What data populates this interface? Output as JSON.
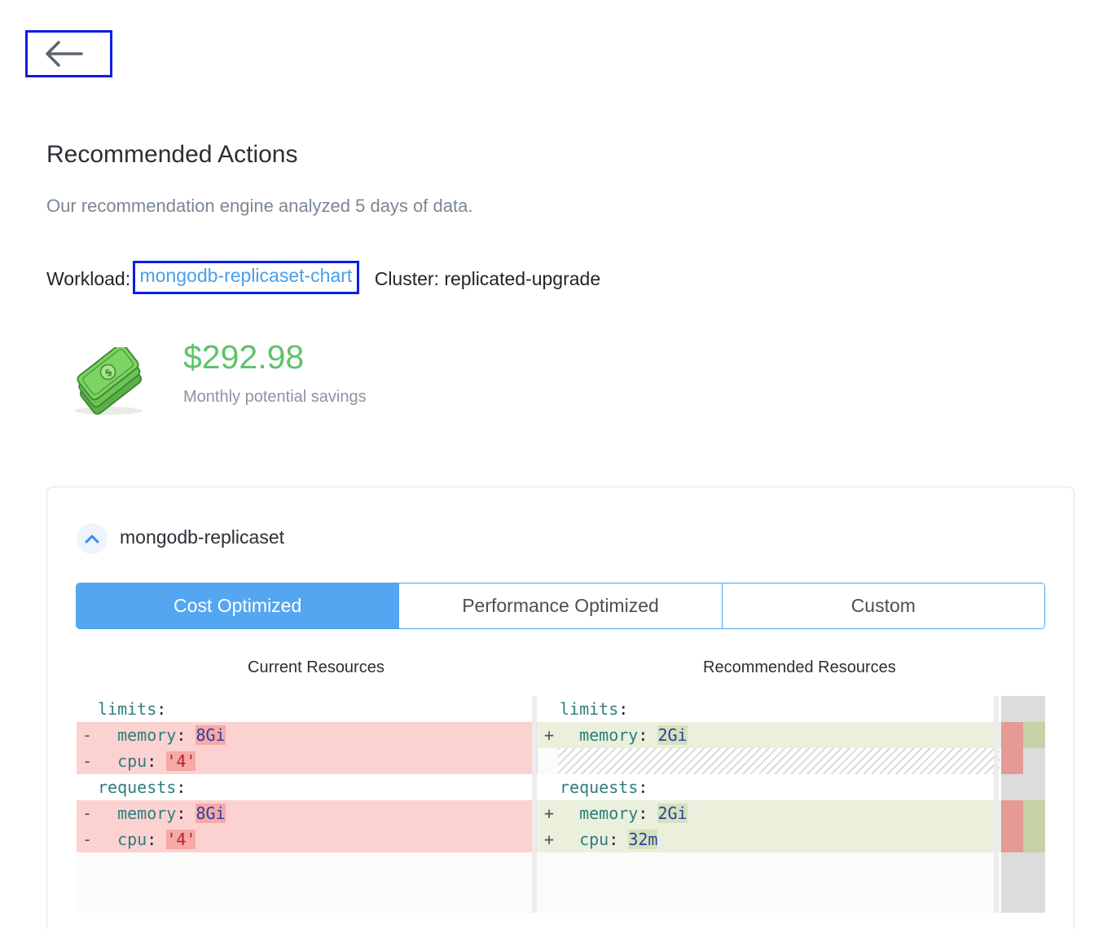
{
  "nav": {
    "back_icon": "arrow-left-icon"
  },
  "page": {
    "title": "Recommended Actions",
    "subtitle": "Our recommendation engine analyzed 5 days of data."
  },
  "workload": {
    "label": "Workload:",
    "name": "mongodb-replicaset-chart",
    "cluster": "Cluster: replicated-upgrade"
  },
  "savings": {
    "icon": "money-icon",
    "value": "$292.98",
    "label": "Monthly potential savings"
  },
  "container": {
    "name": "mongodb-replicaset",
    "collapse_icon": "chevron-up-icon"
  },
  "tabs": [
    {
      "label": "Cost Optimized",
      "active": true
    },
    {
      "label": "Performance Optimized",
      "active": false
    },
    {
      "label": "Custom",
      "active": false
    }
  ],
  "columns": {
    "current": "Current Resources",
    "recommended": "Recommended Resources"
  },
  "current_resources": {
    "limits_key": "limits",
    "requests_key": "requests",
    "limits": [
      {
        "marker": "-",
        "key": "memory",
        "value": "8Gi"
      },
      {
        "marker": "-",
        "key": "cpu",
        "value": "'4'"
      }
    ],
    "requests": [
      {
        "marker": "-",
        "key": "memory",
        "value": "8Gi"
      },
      {
        "marker": "-",
        "key": "cpu",
        "value": "'4'"
      }
    ]
  },
  "recommended_resources": {
    "limits_key": "limits",
    "requests_key": "requests",
    "limits": [
      {
        "marker": "+",
        "key": "memory",
        "value": "2Gi"
      }
    ],
    "requests": [
      {
        "marker": "+",
        "key": "memory",
        "value": "2Gi"
      },
      {
        "marker": "+",
        "key": "cpu",
        "value": "32m"
      }
    ]
  },
  "colors": {
    "accent": "#53a6ef",
    "link": "#4a9fe8",
    "savings": "#5fc26a",
    "removed_bg": "#fbd2d0",
    "added_bg": "#eaf0dc"
  }
}
